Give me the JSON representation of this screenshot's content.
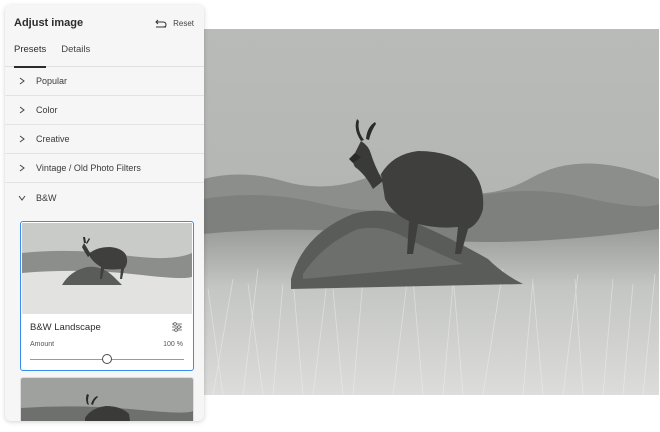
{
  "panel": {
    "title": "Adjust image",
    "reset_label": "Reset",
    "tabs": [
      {
        "label": "Presets",
        "active": true
      },
      {
        "label": "Details",
        "active": false
      }
    ],
    "categories": [
      {
        "label": "Popular",
        "expanded": false
      },
      {
        "label": "Color",
        "expanded": false
      },
      {
        "label": "Creative",
        "expanded": false
      },
      {
        "label": "Vintage / Old Photo Filters",
        "expanded": false
      },
      {
        "label": "B&W",
        "expanded": true
      }
    ]
  },
  "preset_card": {
    "name": "B&W Landscape",
    "amount_label": "Amount",
    "amount_value": "100 %",
    "amount_level": 0.5,
    "selected": true
  },
  "colors": {
    "accent": "#378ef0",
    "panel_bg": "#f6f6f6"
  },
  "icons": [
    "reset-undo-icon",
    "chevron-right-icon",
    "chevron-down-icon",
    "sliders-settings-icon"
  ]
}
